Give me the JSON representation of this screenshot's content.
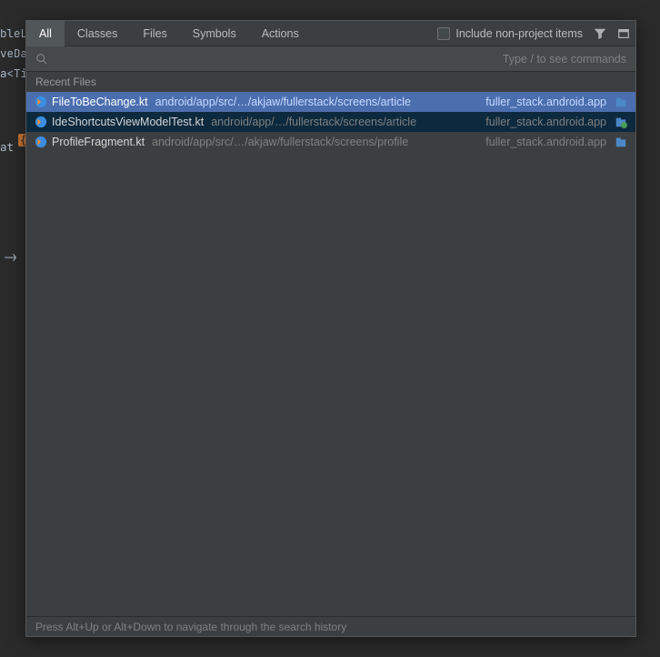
{
  "editor": {
    "line1": "bleLiveData: MutableLiveData<Shortcuts> = MutableLiveData()",
    "line2": "veDa",
    "line3": "a<Ti",
    "line_t": "at",
    "line_brace": "{",
    "arrow": "->"
  },
  "popup": {
    "tabs": [
      {
        "label": "All",
        "active": true
      },
      {
        "label": "Classes",
        "active": false
      },
      {
        "label": "Files",
        "active": false
      },
      {
        "label": "Symbols",
        "active": false
      },
      {
        "label": "Actions",
        "active": false
      }
    ],
    "include_label": "Include non-project items",
    "search_placeholder": "",
    "search_hint": "Type / to see commands",
    "section": "Recent Files",
    "rows": [
      {
        "filename": "FileToBeChange.kt",
        "path": "android/app/src/…/akjaw/fullerstack/screens/article",
        "module": "fuller_stack.android.app",
        "state": "selected",
        "mod_kind": "app"
      },
      {
        "filename": "IdeShortcutsViewModelTest.kt",
        "path": "android/app/…/fullerstack/screens/article",
        "module": "fuller_stack.android.app",
        "state": "hover",
        "mod_kind": "test"
      },
      {
        "filename": "ProfileFragment.kt",
        "path": "android/app/src/…/akjaw/fullerstack/screens/profile",
        "module": "fuller_stack.android.app",
        "state": "",
        "mod_kind": "app"
      }
    ],
    "footer": "Press Alt+Up or Alt+Down to navigate through the search history"
  }
}
